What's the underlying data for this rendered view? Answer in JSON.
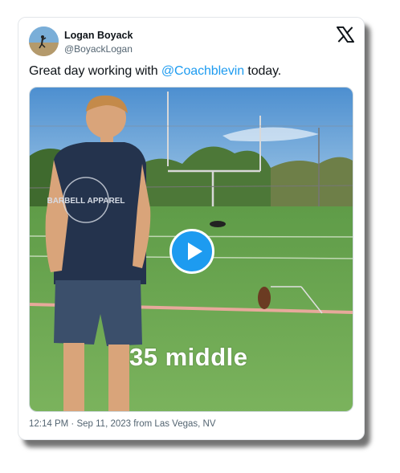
{
  "author": {
    "name": "Logan Boyack",
    "handle": "@BoyackLogan"
  },
  "tweet": {
    "text_before": "Great day working with ",
    "mention": "@Coachblevin",
    "text_after": " today."
  },
  "video": {
    "overlay_caption": "35 middle",
    "shirt_text": "BARBELL APPAREL"
  },
  "meta": {
    "time": "12:14 PM",
    "separator": " · ",
    "date": "Sep 11, 2023",
    "source": " from Las Vegas, NV"
  },
  "colors": {
    "accent": "#1d9bf0",
    "text": "#0f1419",
    "secondary_text": "#536471"
  },
  "icons": {
    "logo": "x-logo-icon",
    "play": "play-icon"
  }
}
